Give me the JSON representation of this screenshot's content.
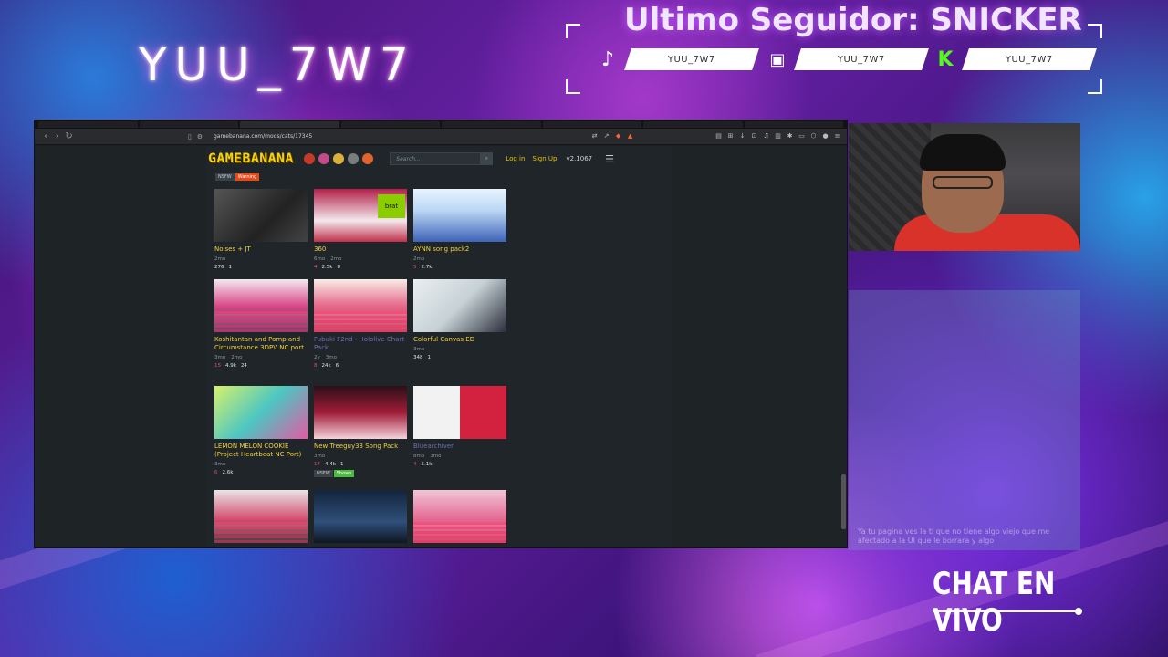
{
  "overlay": {
    "streamer_name": "YUU_7W7",
    "follower_banner": "Ultimo Seguidor: SNICKER",
    "socials": [
      {
        "icon": "tiktok-icon",
        "handle": "YUU_7W7"
      },
      {
        "icon": "twitch-icon",
        "handle": "YUU_7W7"
      },
      {
        "icon": "kick-icon",
        "handle": "YUU_7W7"
      }
    ],
    "chat_title": "CHAT EN VIVO",
    "chat_message": "Ya tu pagina ves la ti que no tiene algo viejo que me afectado a la UI que le borrara y algo"
  },
  "browser": {
    "url": "gamebanana.com/mods/cats/17345"
  },
  "site": {
    "logo": "GAMEBANANA",
    "search_placeholder": "Search...",
    "login": "Log in",
    "signup": "Sign Up",
    "version": "v2.1067",
    "nsfw_label": "NSFW",
    "warning_label": "Warning",
    "shown_label": "Shown"
  },
  "mods": [
    {
      "title": "Noises + JT",
      "meta": [
        "2mo"
      ],
      "stats": [
        "276",
        "1"
      ]
    },
    {
      "title": "360",
      "meta": [
        "6mo",
        "2mo"
      ],
      "stats": [
        "4",
        "2.5k",
        "8"
      ]
    },
    {
      "title": "AYNN song pack2",
      "meta": [
        "2mo"
      ],
      "stats": [
        "5",
        "2.7k"
      ]
    },
    {
      "title": "Koshitantan and Pomp and Circumstance 3DPV NC port",
      "meta": [
        "3mo",
        "2mo"
      ],
      "stats": [
        "15",
        "4.9k",
        "24"
      ]
    },
    {
      "title": "Fubuki F2nd - Hololive Chart Pack",
      "meta": [
        "2y",
        "3mo"
      ],
      "stats": [
        "8",
        "24k",
        "6"
      ]
    },
    {
      "title": "Colorful Canvas ED",
      "meta": [
        "3mo"
      ],
      "stats": [
        "348",
        "1"
      ]
    },
    {
      "title": "LEMON MELON COOKIE (Project Heartbeat NC Port)",
      "meta": [
        "3mo"
      ],
      "stats": [
        "6",
        "2.6k"
      ]
    },
    {
      "title": "New Treeguy33 Song Pack",
      "meta": [
        "3mo"
      ],
      "stats": [
        "17",
        "4.4k",
        "1"
      ]
    },
    {
      "title": "Bluearchiver",
      "meta": [
        "8mo",
        "3mo"
      ],
      "stats": [
        "4",
        "5.1k"
      ]
    }
  ]
}
